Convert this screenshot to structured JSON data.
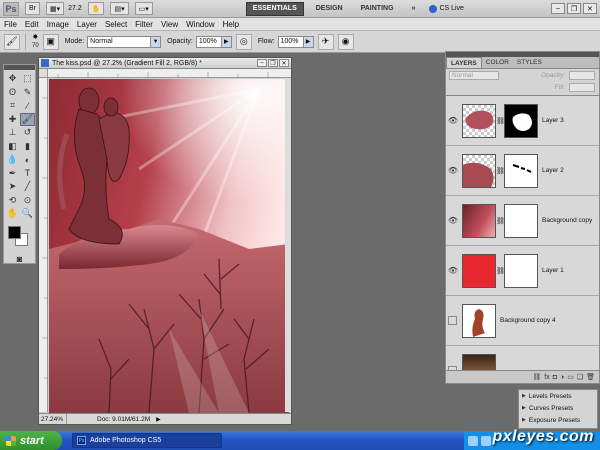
{
  "app": {
    "logo": "Ps",
    "zoom_value": "27.2",
    "workspaces": [
      "ESSENTIALS",
      "DESIGN",
      "PAINTING"
    ],
    "more": "»",
    "cs_live": "CS Live"
  },
  "menu": [
    "File",
    "Edit",
    "Image",
    "Layer",
    "Select",
    "Filter",
    "View",
    "Window",
    "Help"
  ],
  "options": {
    "brush_size": "70",
    "mode_label": "Mode:",
    "mode_value": "Normal",
    "opacity_label": "Opacity:",
    "opacity_value": "100%",
    "flow_label": "Flow:",
    "flow_value": "100%"
  },
  "document": {
    "title": "The kiss.psd @ 27.2% (Gradient Fill 2, RGB/8) *",
    "zoom": "27.24%",
    "doc_info": "Doc: 9.01M/61.2M"
  },
  "layers_panel": {
    "tabs": [
      "LAYERS",
      "COLOR",
      "STYLES"
    ],
    "blend_mode": "Normal",
    "opacity_label": "Opacity:",
    "fill_label": "Fill:",
    "layers": [
      {
        "name": "Layer 3",
        "visible": true
      },
      {
        "name": "Layer 2",
        "visible": true
      },
      {
        "name": "Background copy",
        "visible": true
      },
      {
        "name": "Layer 1",
        "visible": true
      },
      {
        "name": "Background copy 4",
        "visible": false
      },
      {
        "name": "",
        "visible": false
      }
    ],
    "bottom_icons": [
      "link-icon",
      "fx-icon",
      "mask-icon",
      "adjustment-icon",
      "folder-icon",
      "new-layer-icon",
      "trash-icon"
    ]
  },
  "presets": [
    "Levels Presets",
    "Curves Presets",
    "Exposure Presets"
  ],
  "taskbar": {
    "start": "start",
    "item": "Adobe Photoshop CS5",
    "watermark": "pxleyes.com"
  },
  "colors": {
    "canvas_red": "#b5404a",
    "layer1_red": "#e8282e",
    "accent_blue": "#2457c5"
  }
}
